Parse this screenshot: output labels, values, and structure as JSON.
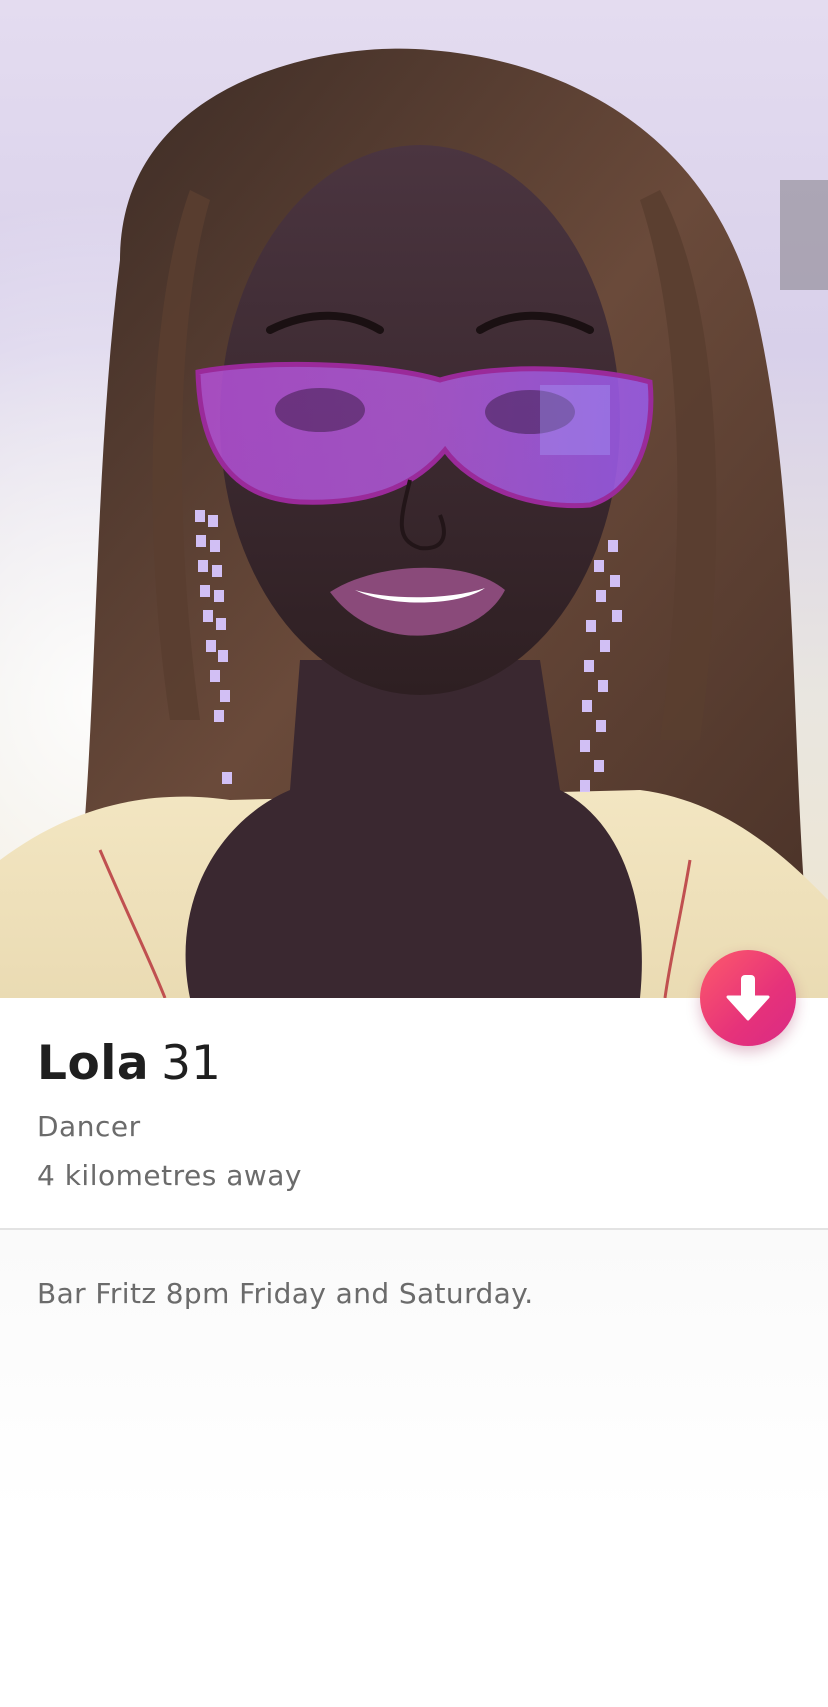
{
  "profile": {
    "name": "Lola",
    "age": "31",
    "job": "Dancer",
    "distance": "4 kilometres away",
    "bio": "Bar Fritz 8pm Friday and Saturday."
  },
  "colors": {
    "fab_start": "#fd5a6b",
    "fab_end": "#d92a85",
    "text_primary": "#1f1f1f",
    "text_secondary": "#6b6b6b"
  },
  "icons": {
    "fab": "arrow-down-icon"
  }
}
